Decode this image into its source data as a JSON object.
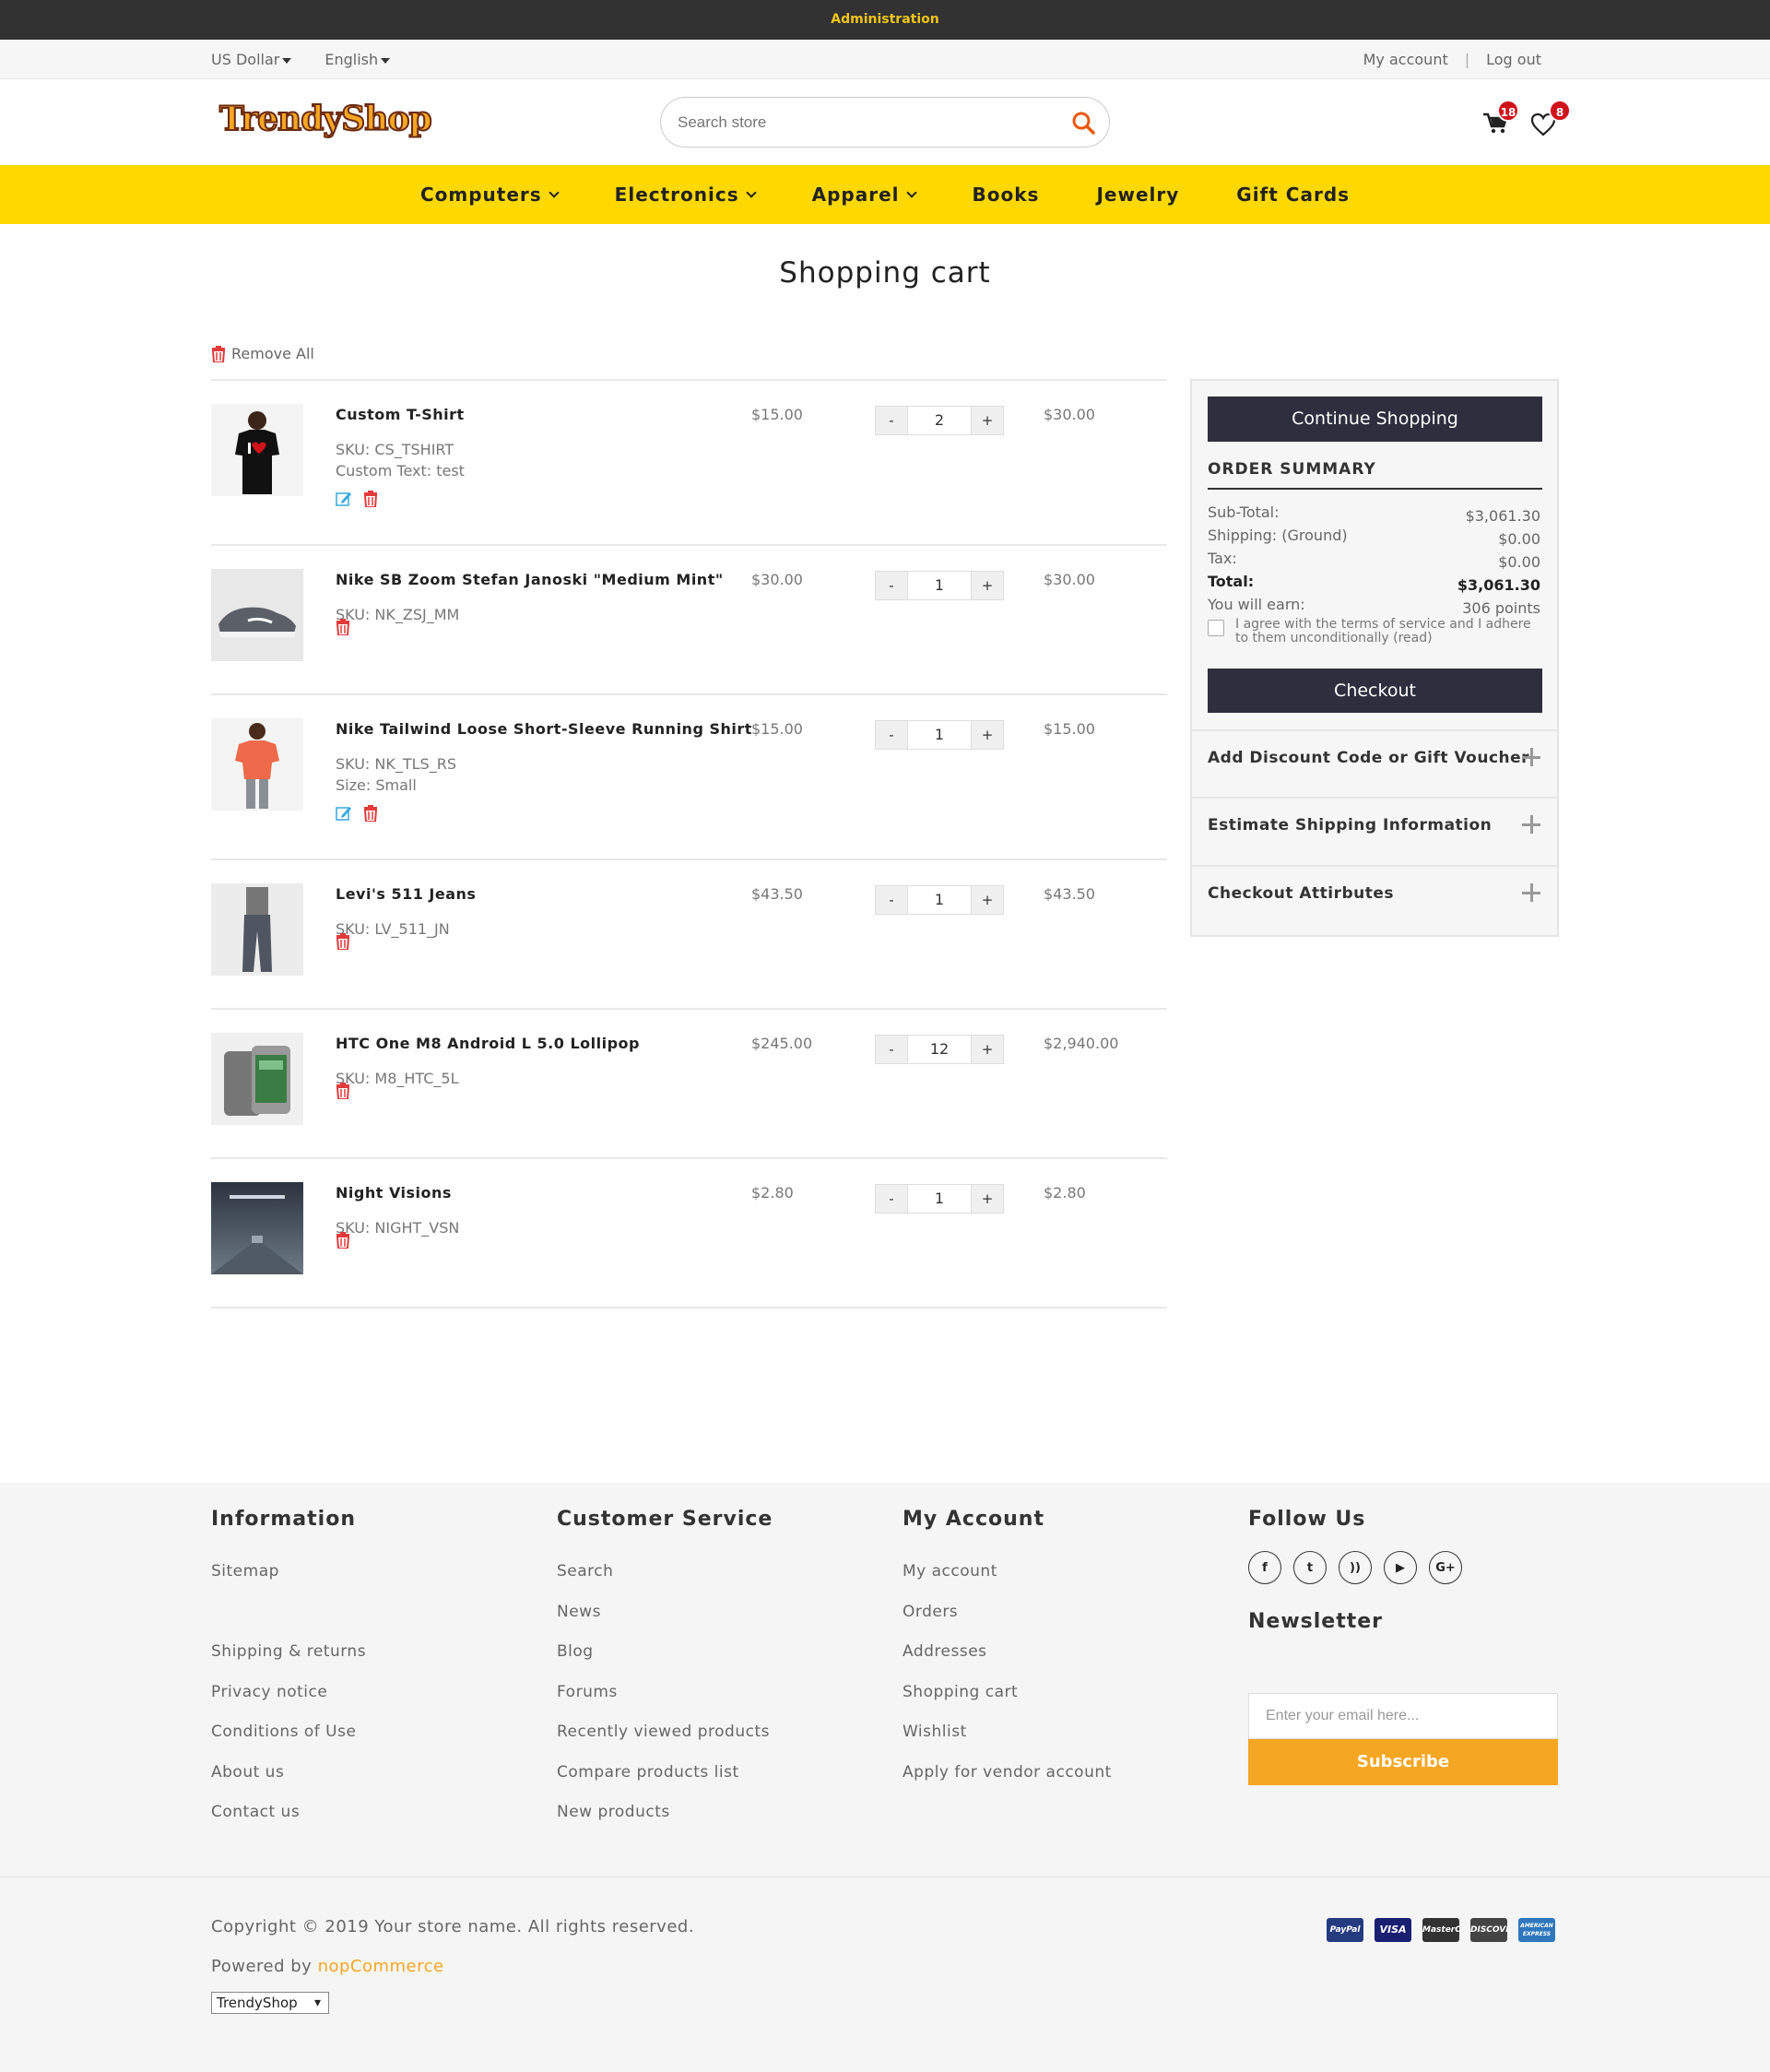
{
  "admin_bar": {
    "label": "Administration"
  },
  "top_bar": {
    "currency": "US Dollar",
    "language": "English",
    "my_account": "My account",
    "separator": "|",
    "logout": "Log out"
  },
  "header": {
    "logo_text": "TrendyShop",
    "search_placeholder": "Search store",
    "cart_count": "18",
    "wishlist_count": "8"
  },
  "nav": {
    "items": [
      {
        "label": "Computers",
        "dropdown": true
      },
      {
        "label": "Electronics",
        "dropdown": true
      },
      {
        "label": "Apparel",
        "dropdown": true
      },
      {
        "label": "Books",
        "dropdown": false
      },
      {
        "label": "Jewelry",
        "dropdown": false
      },
      {
        "label": "Gift Cards",
        "dropdown": false
      }
    ]
  },
  "page": {
    "title": "Shopping cart",
    "remove_all": "Remove All"
  },
  "cart": {
    "items": [
      {
        "name": "Custom T-Shirt",
        "sku": "SKU: CS_TSHIRT",
        "attr": "Custom Text: test",
        "price": "$15.00",
        "qty": "2",
        "total": "$30.00",
        "editable": true,
        "image": "tshirt-image"
      },
      {
        "name": "Nike SB Zoom Stefan Janoski \"Medium Mint\"",
        "sku": "SKU: NK_ZSJ_MM",
        "attr": "",
        "price": "$30.00",
        "qty": "1",
        "total": "$30.00",
        "editable": false,
        "image": "shoe-image"
      },
      {
        "name": "Nike Tailwind Loose Short-Sleeve Running Shirt",
        "sku": "SKU: NK_TLS_RS",
        "attr": "Size: Small",
        "price": "$15.00",
        "qty": "1",
        "total": "$15.00",
        "editable": true,
        "image": "running-shirt-image"
      },
      {
        "name": "Levi's 511 Jeans",
        "sku": "SKU: LV_511_JN",
        "attr": "",
        "price": "$43.50",
        "qty": "1",
        "total": "$43.50",
        "editable": false,
        "image": "jeans-image"
      },
      {
        "name": "HTC One M8 Android L 5.0 Lollipop",
        "sku": "SKU: M8_HTC_5L",
        "attr": "",
        "price": "$245.00",
        "qty": "12",
        "total": "$2,940.00",
        "editable": false,
        "image": "phone-image"
      },
      {
        "name": "Night Visions",
        "sku": "SKU: NIGHT_VSN",
        "attr": "",
        "price": "$2.80",
        "qty": "1",
        "total": "$2.80",
        "editable": false,
        "image": "album-image"
      }
    ],
    "minus": "-",
    "plus": "+"
  },
  "summary": {
    "continue_shopping": "Continue Shopping",
    "title": "ORDER SUMMARY",
    "subtotal_label": "Sub-Total:",
    "subtotal": "$3,061.30",
    "shipping_label": "Shipping: (Ground)",
    "shipping": "$0.00",
    "tax_label": "Tax:",
    "tax": "$0.00",
    "total_label": "Total:",
    "total": "$3,061.30",
    "earn_label": "You will earn:",
    "earn": "306 points",
    "terms": "I agree with the terms of service and I adhere to them unconditionally (read)",
    "checkout": "Checkout",
    "accordions": [
      "Add Discount Code or Gift Voucher",
      "Estimate Shipping Information",
      "Checkout Attirbutes"
    ]
  },
  "footer": {
    "information": {
      "title": "Information",
      "links": [
        "Sitemap",
        "",
        "Shipping & returns",
        "Privacy notice",
        "Conditions of Use",
        "About us",
        "Contact us"
      ]
    },
    "customer_service": {
      "title": "Customer Service",
      "links": [
        "Search",
        "News",
        "Blog",
        "Forums",
        "Recently viewed products",
        "Compare products list",
        "New products"
      ]
    },
    "my_account": {
      "title": "My Account",
      "links": [
        "My account",
        "Orders",
        "Addresses",
        "Shopping cart",
        "Wishlist",
        "Apply for vendor account"
      ]
    },
    "follow_us": {
      "title": "Follow Us",
      "social": [
        "facebook-icon",
        "twitter-icon",
        "rss-icon",
        "youtube-icon",
        "google-plus-icon"
      ]
    },
    "newsletter": {
      "title": "Newsletter",
      "placeholder": "Enter your email here...",
      "button": "Subscribe"
    }
  },
  "bottom": {
    "copyright": "Copyright © 2019 Your store name. All rights reserved.",
    "powered_by": "Powered by",
    "powered_link": "nopCommerce",
    "store_select": "TrendyShop",
    "payment_cards": [
      "PayPal",
      "VISA",
      "MasterCard",
      "DISCOVER",
      "AMERICAN EXPRESS"
    ]
  },
  "colors": {
    "accent_yellow": "#ffd800",
    "dark": "#2d2f3e",
    "orange": "#f5a623",
    "delete_red": "#e33b3b",
    "edit_blue": "#35a8e0"
  }
}
